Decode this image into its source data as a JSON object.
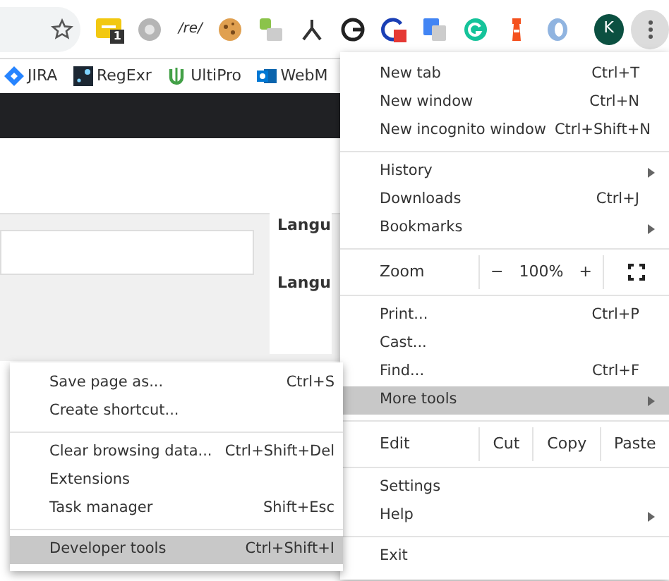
{
  "toolbar": {
    "regex_label": "/re/",
    "badge_count": "1",
    "profile_initial": "K"
  },
  "bookmarks": [
    {
      "label": "JIRA",
      "kind": "jira"
    },
    {
      "label": "RegExr",
      "kind": "regexr"
    },
    {
      "label": "UltiPro",
      "kind": "ultipro"
    },
    {
      "label": "WebM",
      "kind": "outlook"
    }
  ],
  "page": {
    "card_labels": [
      "Langu",
      "Langu"
    ]
  },
  "menu": {
    "sections": [
      [
        {
          "kind": "item",
          "label": "New tab",
          "shortcut": "Ctrl+T",
          "submenu": false,
          "selected": false
        },
        {
          "kind": "item",
          "label": "New window",
          "shortcut": "Ctrl+N",
          "submenu": false,
          "selected": false
        },
        {
          "kind": "item",
          "label": "New incognito window",
          "shortcut": "Ctrl+Shift+N",
          "submenu": false,
          "selected": false
        }
      ],
      [
        {
          "kind": "item",
          "label": "History",
          "submenu": true,
          "selected": false
        },
        {
          "kind": "item",
          "label": "Downloads",
          "shortcut": "Ctrl+J",
          "submenu": false,
          "selected": false
        },
        {
          "kind": "item",
          "label": "Bookmarks",
          "submenu": true,
          "selected": false
        }
      ],
      [
        {
          "kind": "zoom",
          "label": "Zoom",
          "minus": "−",
          "value": "100%",
          "plus": "+"
        }
      ],
      [
        {
          "kind": "item",
          "label": "Print...",
          "shortcut": "Ctrl+P",
          "submenu": false,
          "selected": false
        },
        {
          "kind": "item",
          "label": "Cast...",
          "submenu": false,
          "selected": false
        },
        {
          "kind": "item",
          "label": "Find...",
          "shortcut": "Ctrl+F",
          "submenu": false,
          "selected": false
        },
        {
          "kind": "item",
          "label": "More tools",
          "submenu": true,
          "selected": true
        }
      ],
      [
        {
          "kind": "edit",
          "label": "Edit",
          "actions": [
            "Cut",
            "Copy",
            "Paste"
          ]
        }
      ],
      [
        {
          "kind": "item",
          "label": "Settings",
          "submenu": false,
          "selected": false
        },
        {
          "kind": "item",
          "label": "Help",
          "submenu": true,
          "selected": false
        }
      ],
      [
        {
          "kind": "item",
          "label": "Exit",
          "submenu": false,
          "selected": false
        }
      ]
    ]
  },
  "submenu": {
    "sections": [
      [
        {
          "label": "Save page as...",
          "shortcut": "Ctrl+S",
          "selected": false
        },
        {
          "label": "Create shortcut...",
          "selected": false
        }
      ],
      [
        {
          "label": "Clear browsing data...",
          "shortcut": "Ctrl+Shift+Del",
          "selected": false
        },
        {
          "label": "Extensions",
          "selected": false
        },
        {
          "label": "Task manager",
          "shortcut": "Shift+Esc",
          "selected": false
        }
      ],
      [
        {
          "label": "Developer tools",
          "shortcut": "Ctrl+Shift+I",
          "selected": true
        }
      ]
    ]
  }
}
